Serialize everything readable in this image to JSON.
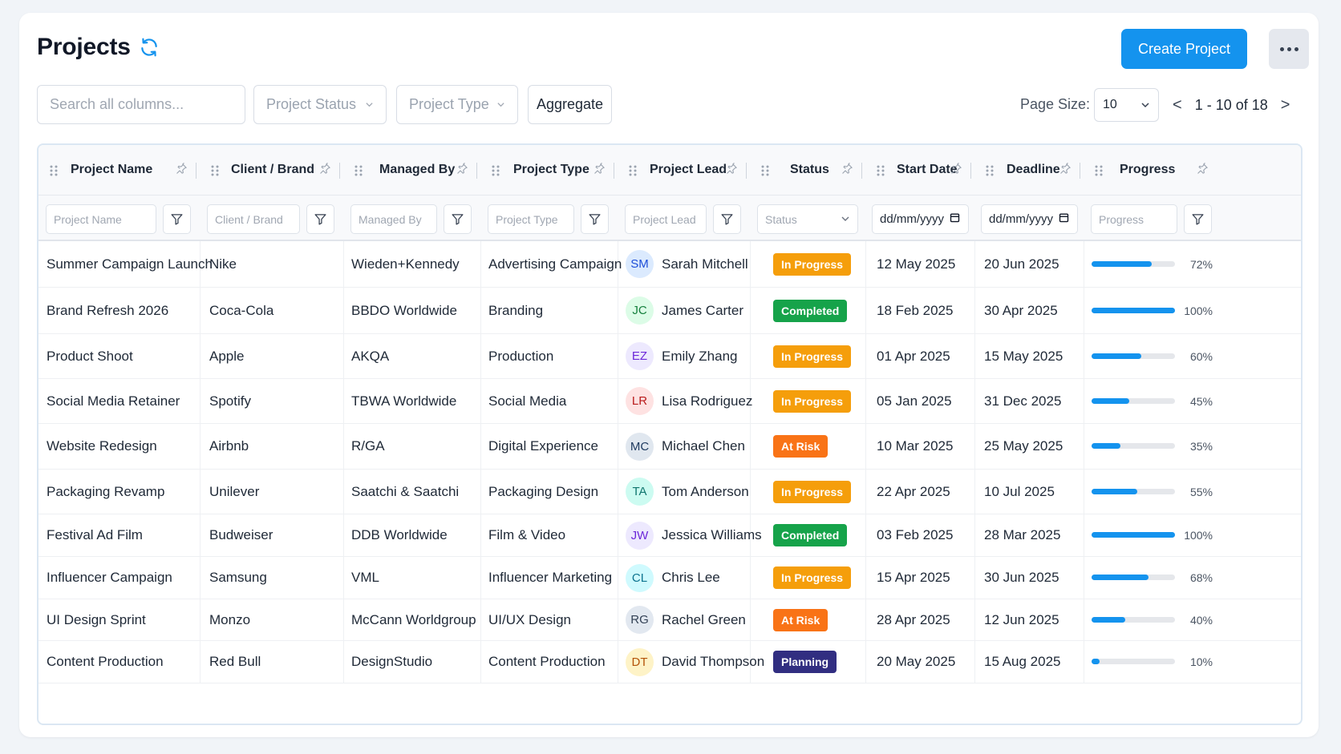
{
  "header": {
    "title": "Projects",
    "create_label": "Create Project",
    "more_icon": "more-horizontal-icon",
    "refresh_icon": "refresh-icon"
  },
  "toolbar": {
    "search_placeholder": "Search all columns...",
    "status_filter": "Project Status",
    "type_filter": "Project Type",
    "aggregate_label": "Aggregate",
    "page_size_label": "Page Size:",
    "page_size_value": "10",
    "pagination_text": "1 - 10 of 18",
    "prev_label": "<",
    "next_label": ">"
  },
  "columns": [
    {
      "key": "name",
      "label": "Project Name",
      "filter_placeholder": "Project Name",
      "filter_kind": "text"
    },
    {
      "key": "client",
      "label": "Client / Brand",
      "filter_placeholder": "Client / Brand",
      "filter_kind": "text"
    },
    {
      "key": "managed",
      "label": "Managed By",
      "filter_placeholder": "Managed By",
      "filter_kind": "text"
    },
    {
      "key": "type",
      "label": "Project Type",
      "filter_placeholder": "Project Type",
      "filter_kind": "text"
    },
    {
      "key": "lead",
      "label": "Project Lead",
      "filter_placeholder": "Project Lead",
      "filter_kind": "text"
    },
    {
      "key": "status",
      "label": "Status",
      "filter_placeholder": "Status",
      "filter_kind": "select"
    },
    {
      "key": "start",
      "label": "Start Date",
      "filter_placeholder": "dd/mm/yyyy",
      "filter_kind": "date"
    },
    {
      "key": "deadline",
      "label": "Deadline",
      "filter_placeholder": "dd/mm/yyyy",
      "filter_kind": "date"
    },
    {
      "key": "progress",
      "label": "Progress",
      "filter_placeholder": "Progress",
      "filter_kind": "text"
    }
  ],
  "status_colors": {
    "In Progress": "#f59e0b",
    "Completed": "#16a34a",
    "At Risk": "#f97316",
    "Planning": "#312e81"
  },
  "rows": [
    {
      "name": "Summer Campaign Launch",
      "client": "Nike",
      "managed": "Wieden+Kennedy",
      "type": "Advertising Campaign",
      "initials": "SM",
      "lead": "Sarah Mitchell",
      "avatar_bg": "#dbeafe",
      "avatar_fg": "#1d4ed8",
      "status": "In Progress",
      "start": "12 May 2025",
      "deadline": "20 Jun 2025",
      "progress": 72,
      "progress_label": "72%"
    },
    {
      "name": "Brand Refresh 2026",
      "client": "Coca-Cola",
      "managed": "BBDO Worldwide",
      "type": "Branding",
      "initials": "JC",
      "lead": "James Carter",
      "avatar_bg": "#dcfce7",
      "avatar_fg": "#15803d",
      "status": "Completed",
      "start": "18 Feb 2025",
      "deadline": "30 Apr 2025",
      "progress": 100,
      "progress_label": "100%"
    },
    {
      "name": "Product Shoot",
      "client": "Apple",
      "managed": "AKQA",
      "type": "Production",
      "initials": "EZ",
      "lead": "Emily Zhang",
      "avatar_bg": "#ede9fe",
      "avatar_fg": "#6d28d9",
      "status": "In Progress",
      "start": "01 Apr 2025",
      "deadline": "15 May 2025",
      "progress": 60,
      "progress_label": "60%"
    },
    {
      "name": "Social Media Retainer",
      "client": "Spotify",
      "managed": "TBWA Worldwide",
      "type": "Social Media",
      "initials": "LR",
      "lead": "Lisa Rodriguez",
      "avatar_bg": "#fee2e2",
      "avatar_fg": "#b91c1c",
      "status": "In Progress",
      "start": "05 Jan 2025",
      "deadline": "31 Dec 2025",
      "progress": 45,
      "progress_label": "45%"
    },
    {
      "name": "Website Redesign",
      "client": "Airbnb",
      "managed": "R/GA",
      "type": "Digital Experience",
      "initials": "MC",
      "lead": "Michael Chen",
      "avatar_bg": "#e0e7ef",
      "avatar_fg": "#1e3a5f",
      "status": "At Risk",
      "start": "10 Mar 2025",
      "deadline": "25 May 2025",
      "progress": 35,
      "progress_label": "35%"
    },
    {
      "name": "Packaging Revamp",
      "client": "Unilever",
      "managed": "Saatchi & Saatchi",
      "type": "Packaging Design",
      "initials": "TA",
      "lead": "Tom Anderson",
      "avatar_bg": "#ccfbf1",
      "avatar_fg": "#0f766e",
      "status": "In Progress",
      "start": "22 Apr 2025",
      "deadline": "10 Jul 2025",
      "progress": 55,
      "progress_label": "55%"
    },
    {
      "name": "Festival Ad Film",
      "client": "Budweiser",
      "managed": "DDB Worldwide",
      "type": "Film & Video",
      "initials": "JW",
      "lead": "Jessica Williams",
      "avatar_bg": "#ede9fe",
      "avatar_fg": "#6d28d9",
      "status": "Completed",
      "start": "03 Feb 2025",
      "deadline": "28 Mar 2025",
      "progress": 100,
      "progress_label": "100%"
    },
    {
      "name": "Influencer Campaign",
      "client": "Samsung",
      "managed": "VML",
      "type": "Influencer Marketing",
      "initials": "CL",
      "lead": "Chris Lee",
      "avatar_bg": "#cffafe",
      "avatar_fg": "#0e7490",
      "status": "In Progress",
      "start": "15 Apr 2025",
      "deadline": "30 Jun 2025",
      "progress": 68,
      "progress_label": "68%"
    },
    {
      "name": "UI Design Sprint",
      "client": "Monzo",
      "managed": "McCann Worldgroup",
      "type": "UI/UX Design",
      "initials": "RG",
      "lead": "Rachel Green",
      "avatar_bg": "#e2e8f0",
      "avatar_fg": "#334155",
      "status": "At Risk",
      "start": "28 Apr 2025",
      "deadline": "12 Jun 2025",
      "progress": 40,
      "progress_label": "40%"
    },
    {
      "name": "Content Production",
      "client": "Red Bull",
      "managed": "DesignStudio",
      "type": "Content Production",
      "initials": "DT",
      "lead": "David Thompson",
      "avatar_bg": "#fef3c7",
      "avatar_fg": "#b45309",
      "status": "Planning",
      "start": "20 May 2025",
      "deadline": "15 Aug 2025",
      "progress": 10,
      "progress_label": "10%"
    }
  ]
}
